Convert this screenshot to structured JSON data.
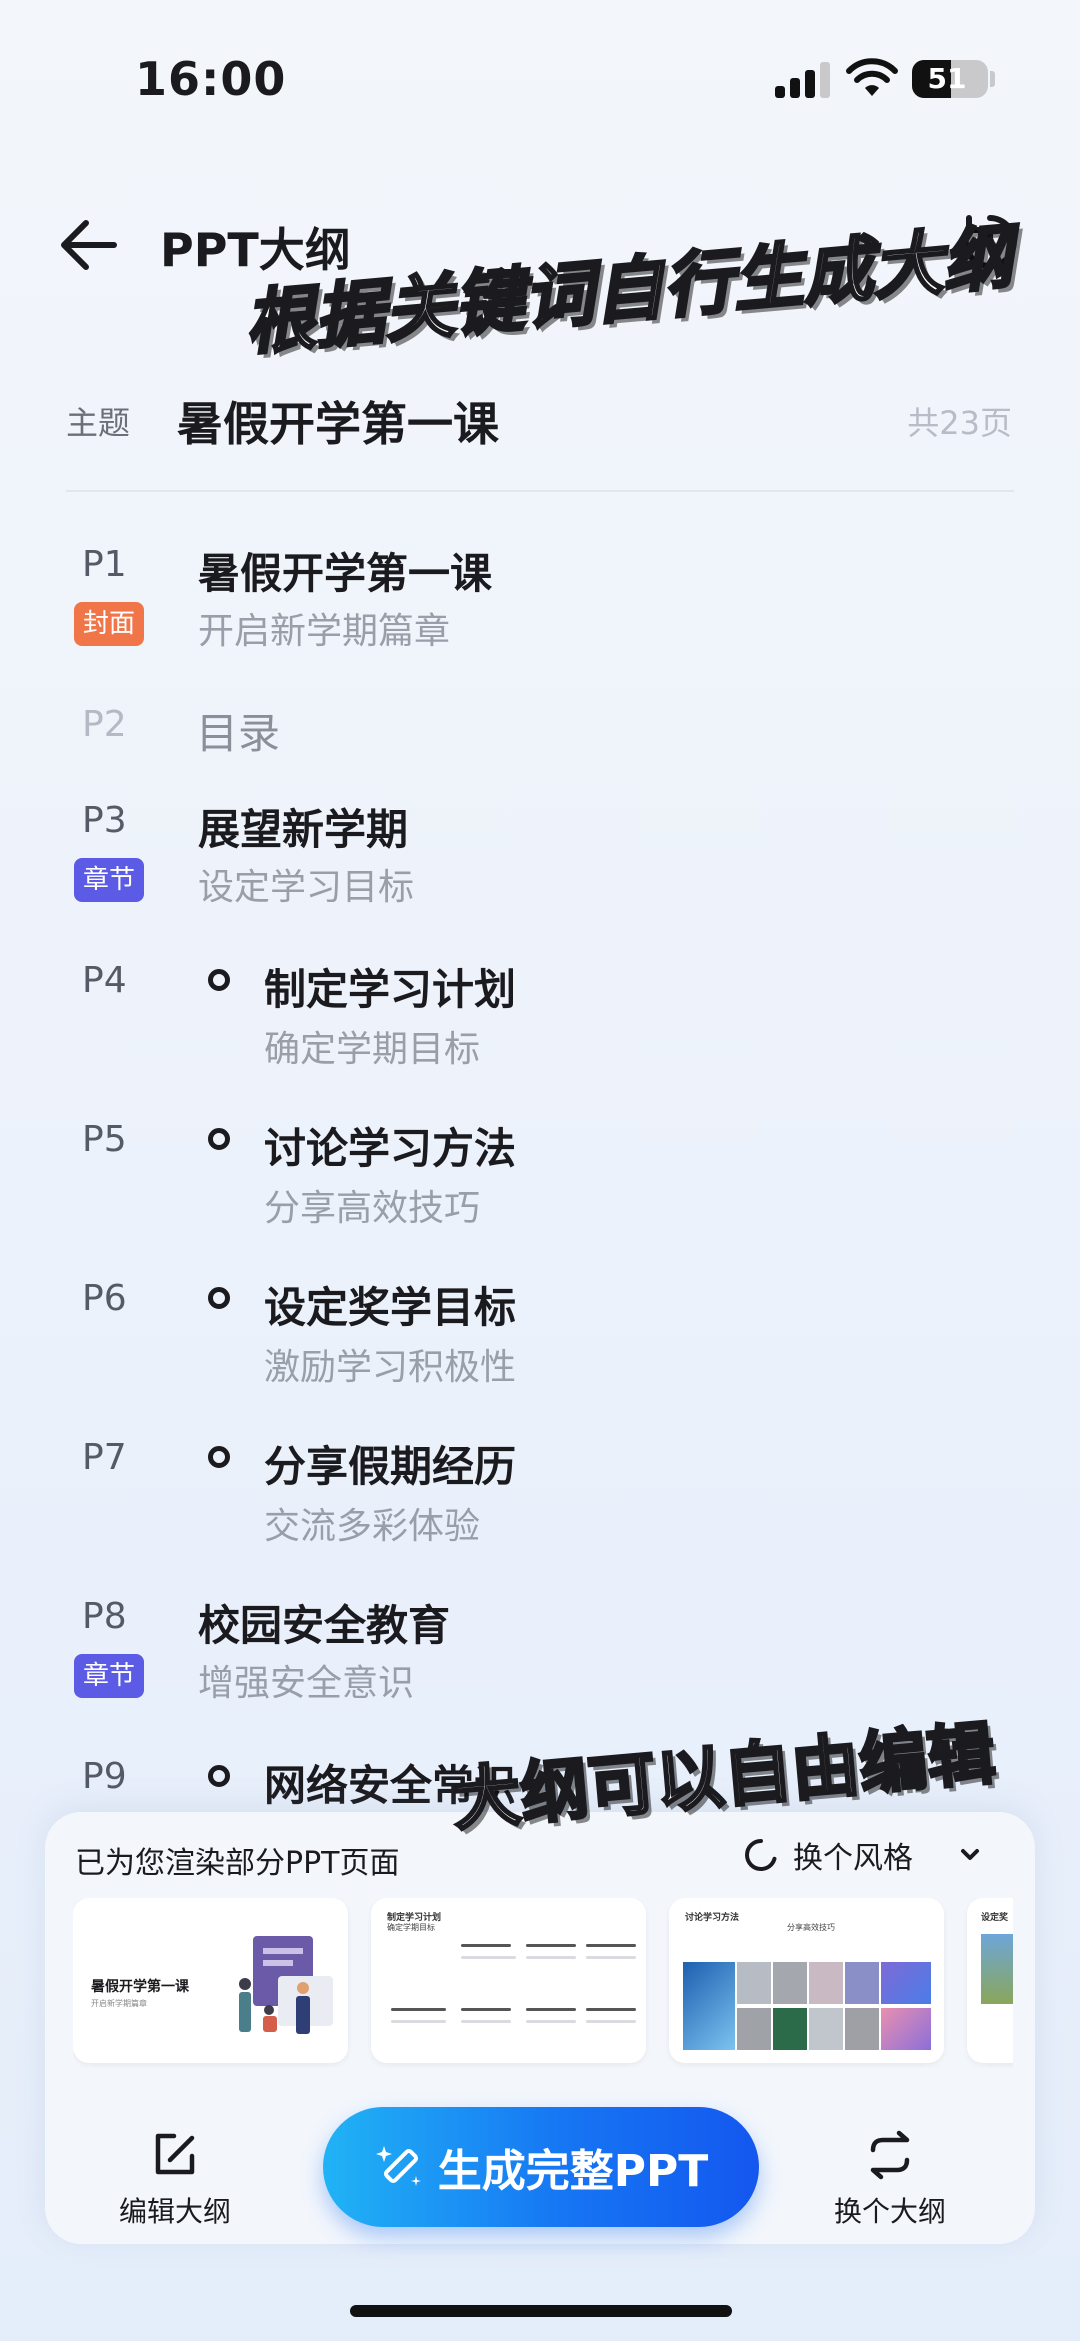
{
  "status_bar": {
    "time": "16:00",
    "battery": "51",
    "battery_level": 0.51
  },
  "header": {
    "title": "PPT大纲",
    "back_icon": "arrow-left-icon",
    "history_icon": "history-clock-icon"
  },
  "captions": {
    "top": "根据关键词自行生成大纲",
    "bottom": "大纲可以自由编辑"
  },
  "theme": {
    "label": "主题",
    "value": "暑假开学第一课",
    "page_count": "共23页"
  },
  "outline": [
    {
      "page": "P1",
      "title": "暑假开学第一课",
      "subtitle": "开启新学期篇章",
      "tag": "封面"
    },
    {
      "page": "P2",
      "title": "目录"
    },
    {
      "page": "P3",
      "title": "展望新学期",
      "subtitle": "设定学习目标",
      "tag": "章节"
    },
    {
      "page": "P4",
      "title": "制定学习计划",
      "subtitle": "确定学期目标"
    },
    {
      "page": "P5",
      "title": "讨论学习方法",
      "subtitle": "分享高效技巧"
    },
    {
      "page": "P6",
      "title": "设定奖学目标",
      "subtitle": "激励学习积极性"
    },
    {
      "page": "P7",
      "title": "分享假期经历",
      "subtitle": "交流多彩体验"
    },
    {
      "page": "P8",
      "title": "校园安全教育",
      "subtitle": "增强安全意识",
      "tag": "章节"
    },
    {
      "page": "P9",
      "title": "网络安全常识"
    }
  ],
  "panel": {
    "rendered_label": "已为您渲染部分PPT页面",
    "style_switch_label": "换个风格",
    "thumbnails": [
      {
        "title": "暑假开学第一课",
        "subtitle": "开启新学期篇章"
      },
      {
        "title": "制定学习计划",
        "subtitle": "确定学期目标"
      },
      {
        "title": "讨论学习方法",
        "subtitle": "分享高效技巧"
      },
      {
        "title": "设定奖"
      }
    ],
    "edit_label": "编辑大纲",
    "generate_label": "生成完整PPT",
    "switch_outline_label": "换个大纲"
  },
  "colors": {
    "accent_blue": "#1676f3",
    "cover_tag": "#f0764a",
    "chapter_tag": "#5b5be6"
  }
}
